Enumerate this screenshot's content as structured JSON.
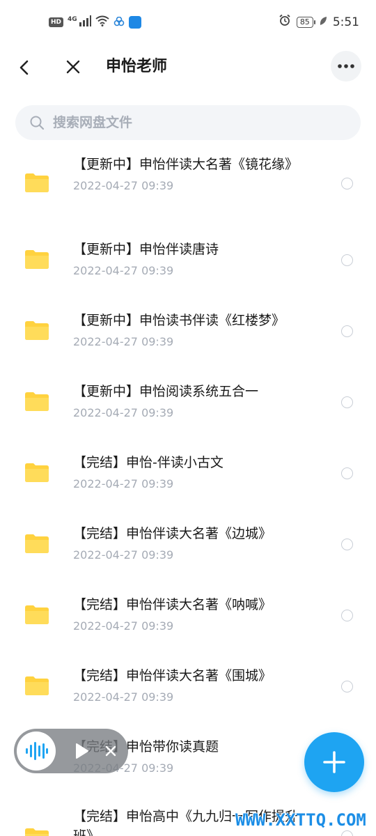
{
  "status_bar": {
    "hd": "HD",
    "network": "4G",
    "battery": "85",
    "time": "5:51",
    "icons": [
      "signal-icon",
      "wifi-icon",
      "link-icon",
      "cloud-app-icon",
      "alarm-icon",
      "leaf-icon"
    ]
  },
  "header": {
    "title": "申怡老师",
    "icons": [
      "back-icon",
      "close-icon",
      "more-icon"
    ]
  },
  "search": {
    "placeholder": "搜索网盘文件"
  },
  "colors": {
    "folder": "#FFD23F",
    "accent": "#1EA4F2",
    "date_text": "#A5ABB5",
    "watermark": "#1C8EE6"
  },
  "files": [
    {
      "name": "【更新中】申怡伴读大名著《镜花缘》",
      "date": "2022-04-27  09:39"
    },
    {
      "name": "【更新中】申怡伴读唐诗",
      "date": "2022-04-27  09:39"
    },
    {
      "name": "【更新中】申怡读书伴读《红楼梦》",
      "date": "2022-04-27  09:39"
    },
    {
      "name": "【更新中】申怡阅读系统五合一",
      "date": "2022-04-27  09:39"
    },
    {
      "name": "【完结】申怡-伴读小古文",
      "date": "2022-04-27  09:39"
    },
    {
      "name": "【完结】申怡伴读大名著《边城》",
      "date": "2022-04-27  09:39"
    },
    {
      "name": "【完结】申怡伴读大名著《呐喊》",
      "date": "2022-04-27  09:39"
    },
    {
      "name": "【完结】申怡伴读大名著《围城》",
      "date": "2022-04-27  09:39"
    },
    {
      "name": "【完结】申怡带你读真题",
      "date": "2022-04-27  09:39"
    },
    {
      "name": "【完结】申怡高中《九九归一写作提升班》",
      "date": ""
    }
  ],
  "player": {
    "icons": [
      "audio-wave-icon",
      "play-icon",
      "close-icon"
    ]
  },
  "fab": {
    "icon": "plus-icon"
  },
  "watermark": "WWW.XXTTQ.COM"
}
